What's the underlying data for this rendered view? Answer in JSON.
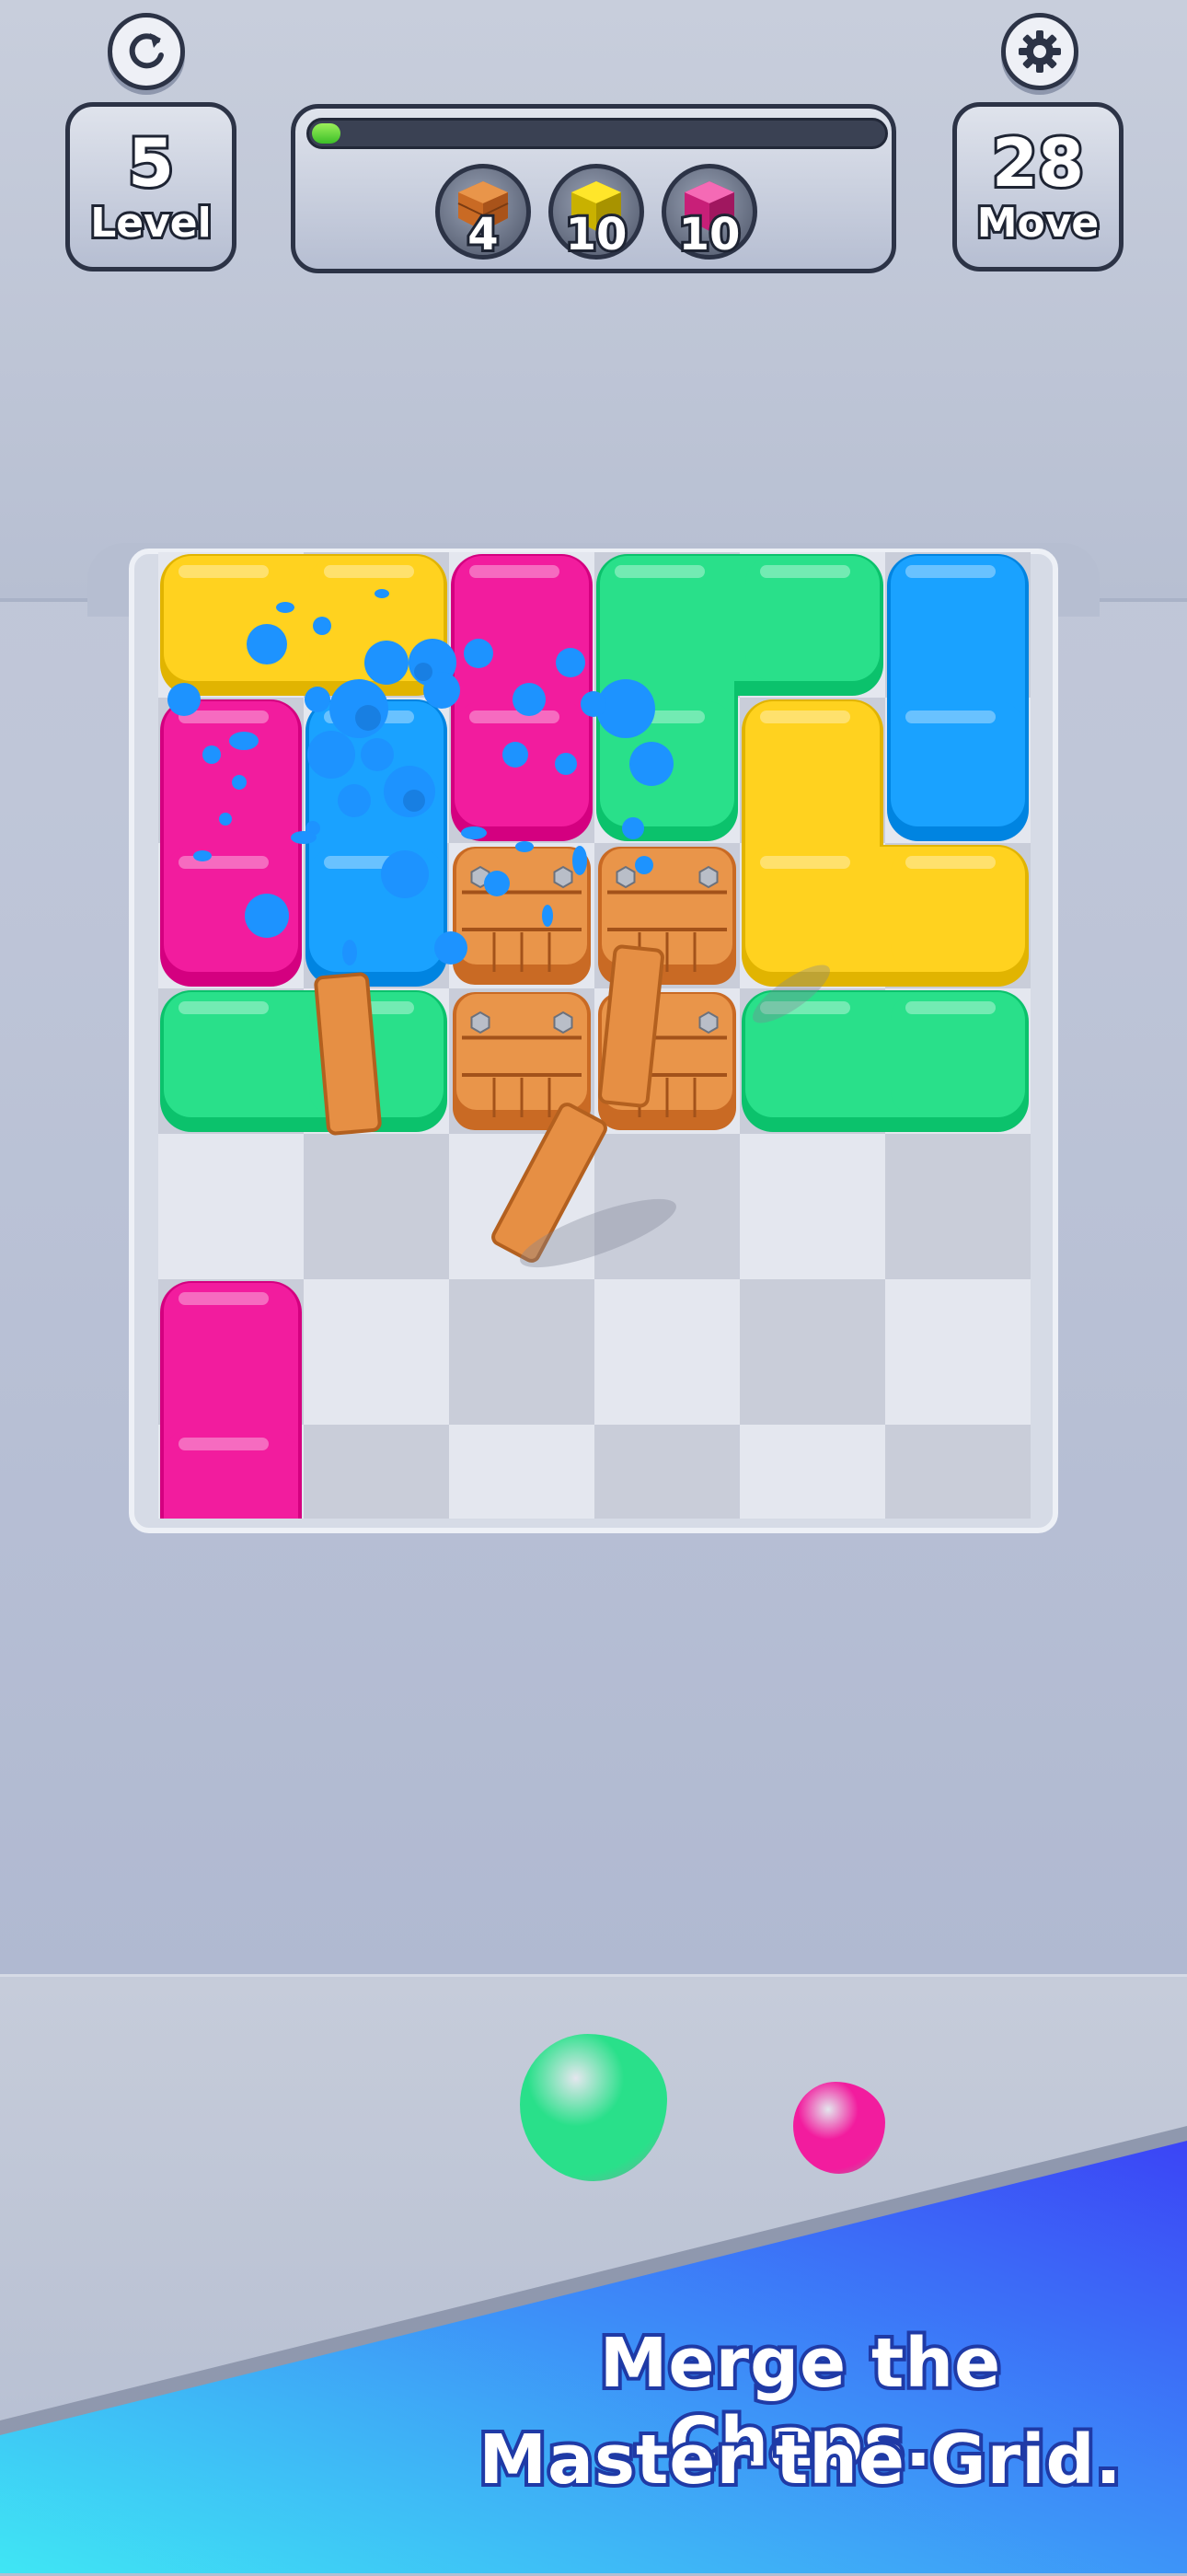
{
  "hud": {
    "level": {
      "value": "5",
      "label": "Level"
    },
    "moves": {
      "value": "28",
      "label": "Move"
    },
    "progress": 0.05,
    "goals": [
      {
        "icon": "wood-crate-icon",
        "count": "4"
      },
      {
        "icon": "yellow-cube-icon",
        "count": "10"
      },
      {
        "icon": "pink-cube-icon",
        "count": "10"
      }
    ],
    "buttons": {
      "restart": "restart-icon",
      "settings": "gear-icon"
    }
  },
  "colors": {
    "yellow": "#ffd21f",
    "pink": "#f21c9e",
    "green": "#29e08a",
    "blue": "#1aa2ff",
    "wood": "#e9954a",
    "banner": "#3b55f6"
  },
  "board": {
    "cols": 6,
    "rows": 7,
    "blocks": [
      {
        "color": "yellow",
        "cells": [
          [
            0,
            0
          ],
          [
            1,
            0
          ]
        ]
      },
      {
        "color": "pink",
        "cells": [
          [
            2,
            0
          ],
          [
            2,
            1
          ]
        ]
      },
      {
        "color": "green",
        "cells": [
          [
            3,
            0
          ],
          [
            4,
            0
          ],
          [
            3,
            1
          ]
        ]
      },
      {
        "color": "blue",
        "cells": [
          [
            5,
            0
          ],
          [
            5,
            1
          ]
        ]
      },
      {
        "color": "pink",
        "cells": [
          [
            0,
            1
          ],
          [
            0,
            2
          ]
        ]
      },
      {
        "color": "blue",
        "cells": [
          [
            1,
            1
          ],
          [
            1,
            2
          ]
        ]
      },
      {
        "color": "yellow",
        "cells": [
          [
            4,
            1
          ],
          [
            4,
            2
          ],
          [
            5,
            2
          ]
        ]
      },
      {
        "color": "green",
        "cells": [
          [
            0,
            3
          ],
          [
            1,
            3
          ]
        ]
      },
      {
        "color": "green",
        "cells": [
          [
            4,
            3
          ],
          [
            5,
            3
          ]
        ]
      },
      {
        "color": "pink",
        "cells": [
          [
            0,
            5
          ],
          [
            0,
            6
          ]
        ]
      }
    ],
    "crates": [
      [
        2,
        2
      ],
      [
        3,
        2
      ],
      [
        2,
        3
      ],
      [
        3,
        3
      ]
    ]
  },
  "queue": [
    {
      "color": "green"
    },
    {
      "color": "pink"
    }
  ],
  "slogan": [
    "Merge the Chaos.",
    "Master the Grid."
  ]
}
